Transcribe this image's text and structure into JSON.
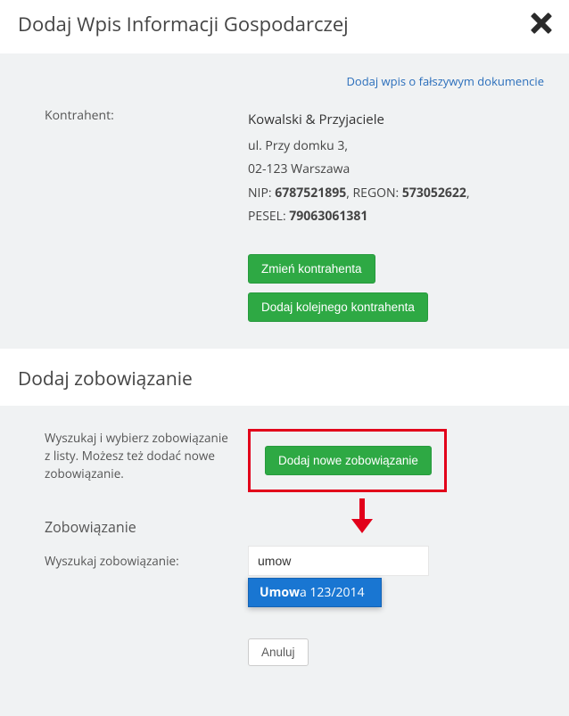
{
  "header": {
    "title": "Dodaj Wpis Informacji Gospodarczej"
  },
  "links": {
    "fake_doc": "Dodaj wpis o fałszywym dokumencie"
  },
  "kontrahent": {
    "label": "Kontrahent:",
    "name": "Kowalski & Przyjaciele",
    "street": "ul. Przy domku 3,",
    "city": "02-123 Warszawa",
    "nip_label": "NIP:",
    "nip": "6787521895",
    "regon_label": "REGON:",
    "regon": "573052622",
    "pesel_label": "PESEL:",
    "pesel": "79063061381",
    "buttons": {
      "change": "Zmień kontrahenta",
      "add_next": "Dodaj kolejnego kontrahenta"
    }
  },
  "obligation": {
    "section_title": "Dodaj zobowiązanie",
    "hint": "Wyszukaj i wybierz zobowiązanie z listy. Możesz też dodać nowe zobowiązanie.",
    "add_button": "Dodaj nowe zobowiązanie",
    "subhead": "Zobowiązanie",
    "search_label": "Wyszukaj zobowiązanie:",
    "search_value": "umow",
    "dropdown": {
      "match": "Umow",
      "rest": "a 123/2014"
    }
  },
  "actions": {
    "cancel": "Anuluj"
  }
}
